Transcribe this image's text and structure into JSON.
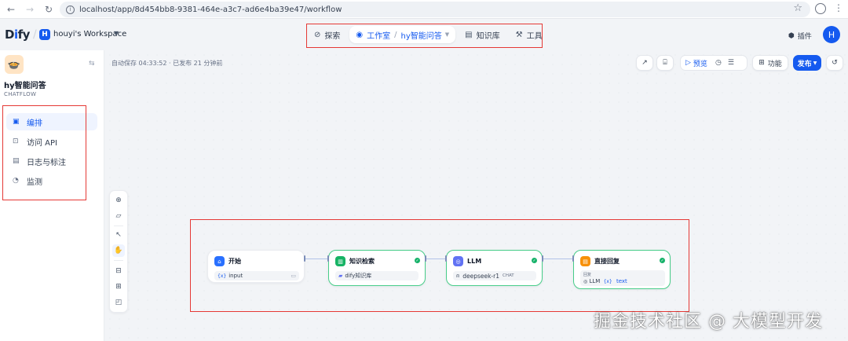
{
  "browser": {
    "url": "localhost/app/8d454bb8-9381-464e-a3c7-ad6e4ba39e47/workflow"
  },
  "header": {
    "logo_main": "D",
    "logo_i": "i",
    "logo_rest": "fy",
    "workspace_initial": "H",
    "workspace_name": "houyi's Workspace",
    "nav": {
      "explore": "探索",
      "studio": "工作室",
      "current_app": "hy智能问答",
      "knowledge": "知识库",
      "tools": "工具"
    },
    "plugins": "插件",
    "user_initial": "H"
  },
  "sidebar": {
    "app_name": "hy智能问答",
    "app_type": "CHATFLOW",
    "items": [
      {
        "label": "编排",
        "icon": "layout-icon"
      },
      {
        "label": "访问 API",
        "icon": "terminal-icon"
      },
      {
        "label": "日志与标注",
        "icon": "document-icon"
      },
      {
        "label": "监测",
        "icon": "monitor-icon"
      }
    ]
  },
  "canvas": {
    "autosave": "自动保存 04:33:52 · 已发布 21 分钟前",
    "preview": "预览",
    "features": "功能",
    "publish": "发布"
  },
  "nodes": {
    "start": {
      "title": "开始",
      "var_tag": "{x}",
      "var_name": "input",
      "color": "#2970ff"
    },
    "knowledge": {
      "title": "知识检索",
      "dataset": "dify知识库",
      "color": "#16b364"
    },
    "llm": {
      "title": "LLM",
      "model": "deepseek-r1",
      "mode": "CHAT",
      "color": "#6172f3"
    },
    "answer": {
      "title": "直接回复",
      "section": "回复",
      "llm_ref": "LLM",
      "var_tag": "{x}",
      "var_name": "text",
      "color": "#f79009"
    }
  },
  "watermark": "掘金技术社区 @ 大模型开发",
  "colors": {
    "accent": "#155aef",
    "success": "#17b26a",
    "highlight": "#e53935"
  }
}
